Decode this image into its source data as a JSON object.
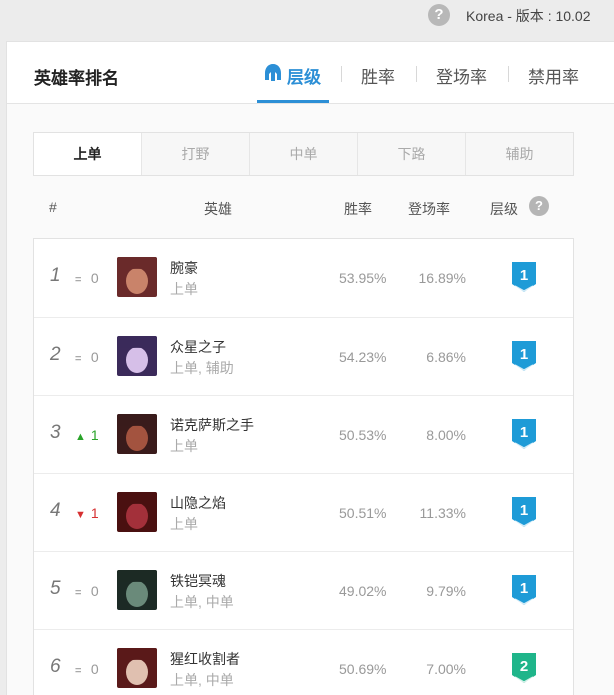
{
  "topbar": {
    "help_glyph": "?",
    "region_label": "Korea - 版本 : 10.02"
  },
  "header": {
    "title": "英雄率排名",
    "tabs": [
      {
        "label": "层级",
        "active": true,
        "icon": "tier-helmet-icon"
      },
      {
        "label": "胜率",
        "active": false
      },
      {
        "label": "登场率",
        "active": false
      },
      {
        "label": "禁用率",
        "active": false
      }
    ]
  },
  "lanes": [
    {
      "label": "上单",
      "active": true
    },
    {
      "label": "打野",
      "active": false
    },
    {
      "label": "中单",
      "active": false
    },
    {
      "label": "下路",
      "active": false
    },
    {
      "label": "辅助",
      "active": false
    }
  ],
  "columns": {
    "rank": "#",
    "hero": "英雄",
    "winrate": "胜率",
    "pickrate": "登场率",
    "tier": "层级",
    "tier_help": "?"
  },
  "colors": {
    "accent": "#2c8fd6",
    "tier1": "#1e9bd7",
    "tier2": "#1fb58a",
    "up": "#29a329",
    "down": "#d63031"
  },
  "rows": [
    {
      "rank": "1",
      "change_dir": "same",
      "change_glyph": "=",
      "change": "0",
      "name": "腕豪",
      "position": "上单",
      "winrate": "53.95%",
      "pickrate": "16.89%",
      "tier": "1",
      "avatar_colors": [
        "#6a2a2a",
        "#c9836a"
      ]
    },
    {
      "rank": "2",
      "change_dir": "same",
      "change_glyph": "=",
      "change": "0",
      "name": "众星之子",
      "position": "上单, 辅助",
      "winrate": "54.23%",
      "pickrate": "6.86%",
      "tier": "1",
      "avatar_colors": [
        "#3b2a5a",
        "#d6bfe8"
      ]
    },
    {
      "rank": "3",
      "change_dir": "up",
      "change_glyph": "▲",
      "change": "1",
      "name": "诺克萨斯之手",
      "position": "上单",
      "winrate": "50.53%",
      "pickrate": "8.00%",
      "tier": "1",
      "avatar_colors": [
        "#3a1b1b",
        "#a3533f"
      ]
    },
    {
      "rank": "4",
      "change_dir": "down",
      "change_glyph": "▼",
      "change": "1",
      "name": "山隐之焰",
      "position": "上单",
      "winrate": "50.51%",
      "pickrate": "11.33%",
      "tier": "1",
      "avatar_colors": [
        "#4a1010",
        "#a3303a"
      ]
    },
    {
      "rank": "5",
      "change_dir": "same",
      "change_glyph": "=",
      "change": "0",
      "name": "铁铠冥魂",
      "position": "上单, 中单",
      "winrate": "49.02%",
      "pickrate": "9.79%",
      "tier": "1",
      "avatar_colors": [
        "#1c2a25",
        "#6a8a7a"
      ]
    },
    {
      "rank": "6",
      "change_dir": "same",
      "change_glyph": "=",
      "change": "0",
      "name": "猩红收割者",
      "position": "上单, 中单",
      "winrate": "50.69%",
      "pickrate": "7.00%",
      "tier": "2",
      "avatar_colors": [
        "#5a1a1a",
        "#e0c0b0"
      ]
    }
  ]
}
